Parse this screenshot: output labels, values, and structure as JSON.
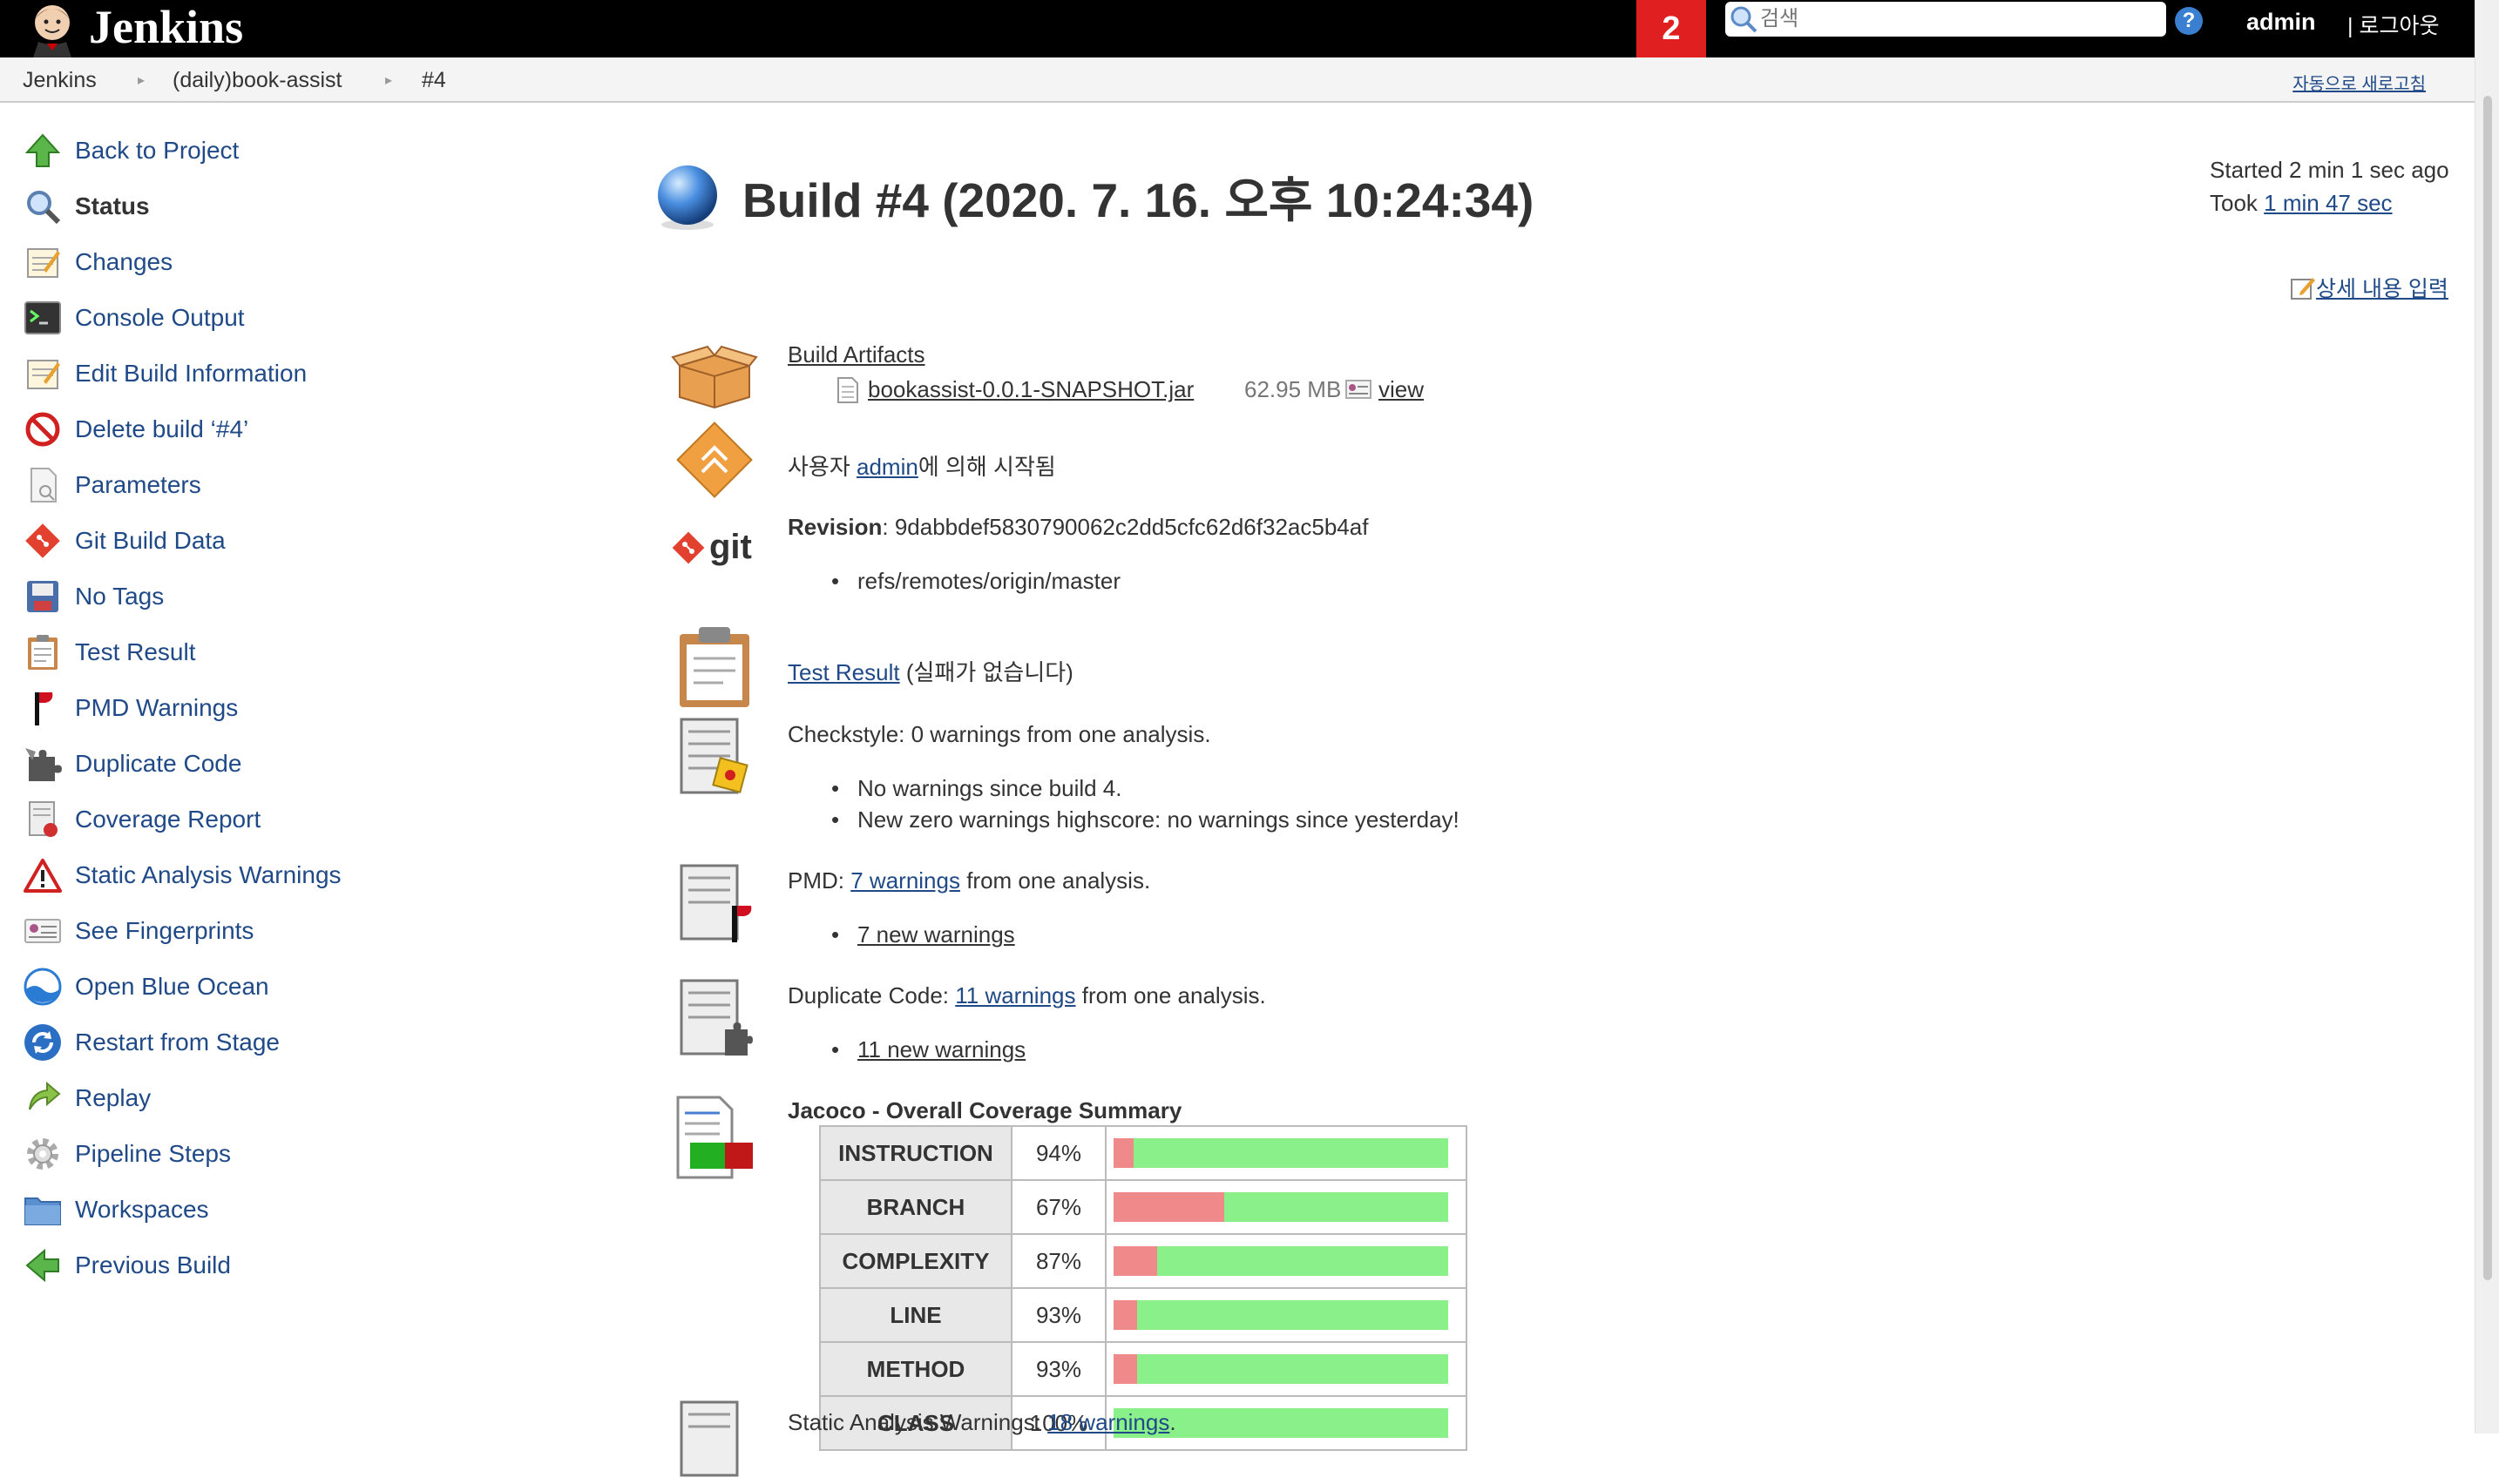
{
  "header": {
    "brand": "Jenkins",
    "notification_count": "2",
    "search_placeholder": "검색",
    "user": "admin",
    "logout": "| 로그아웃"
  },
  "breadcrumb": {
    "items": [
      "Jenkins",
      "(daily)book-assist",
      "#4"
    ],
    "auto_refresh": "자동으로 새로고침"
  },
  "sidebar": {
    "items": [
      {
        "label": "Back to Project",
        "icon": "up-arrow-icon"
      },
      {
        "label": "Status",
        "icon": "magnifier-icon"
      },
      {
        "label": "Changes",
        "icon": "notepad-icon"
      },
      {
        "label": "Console Output",
        "icon": "terminal-icon"
      },
      {
        "label": "Edit Build Information",
        "icon": "notepad-icon"
      },
      {
        "label": "Delete build ‘#4’",
        "icon": "no-entry-icon"
      },
      {
        "label": "Parameters",
        "icon": "document-search-icon"
      },
      {
        "label": "Git Build Data",
        "icon": "git-icon"
      },
      {
        "label": "No Tags",
        "icon": "floppy-icon"
      },
      {
        "label": "Test Result",
        "icon": "clipboard-icon"
      },
      {
        "label": "PMD Warnings",
        "icon": "pmd-flag-icon"
      },
      {
        "label": "Duplicate Code",
        "icon": "puzzle-icon"
      },
      {
        "label": "Coverage Report",
        "icon": "coverage-icon"
      },
      {
        "label": "Static Analysis Warnings",
        "icon": "warning-triangle-icon"
      },
      {
        "label": "See Fingerprints",
        "icon": "fingerprint-card-icon"
      },
      {
        "label": "Open Blue Ocean",
        "icon": "blue-ocean-icon"
      },
      {
        "label": "Restart from Stage",
        "icon": "restart-icon"
      },
      {
        "label": "Replay",
        "icon": "replay-arrow-icon"
      },
      {
        "label": "Pipeline Steps",
        "icon": "gear-icon"
      },
      {
        "label": "Workspaces",
        "icon": "folder-icon"
      },
      {
        "label": "Previous Build",
        "icon": "left-arrow-icon"
      }
    ]
  },
  "build": {
    "title": "Build #4 (2020. 7. 16. 오후 10:24:34)",
    "started": "Started 2 min 1 sec ago",
    "took_prefix": "Took ",
    "took_link": "1 min 47 sec",
    "edit_description": "상세 내용 입력"
  },
  "artifacts": {
    "heading": "Build Artifacts",
    "file": "bookassist-0.0.1-SNAPSHOT.jar",
    "size": "62.95 MB",
    "view": "view"
  },
  "cause": {
    "prefix": "사용자 ",
    "user": "admin",
    "suffix": "에 의해 시작됨"
  },
  "git": {
    "label": "Revision",
    "revision": ": 9dabbdef5830790062c2dd5cfc62d6f32ac5b4af",
    "ref": "refs/remotes/origin/master"
  },
  "test_result": {
    "link": "Test Result",
    "note": " (실패가 없습니다)"
  },
  "checkstyle": {
    "summary": "Checkstyle: 0 warnings from one analysis.",
    "bullets": [
      "No warnings since build 4.",
      "New zero warnings highscore: no warnings since yesterday!"
    ]
  },
  "pmd": {
    "prefix": "PMD: ",
    "link": "7 warnings",
    "suffix": " from one analysis.",
    "new_link": "7 new warnings"
  },
  "duplicate": {
    "prefix": "Duplicate Code: ",
    "link": "11 warnings",
    "suffix": " from one analysis.",
    "new_link": "11 new warnings"
  },
  "jacoco": {
    "title": "Jacoco - Overall Coverage Summary",
    "rows": [
      {
        "name": "INSTRUCTION",
        "pct": "94%",
        "value": 94
      },
      {
        "name": "BRANCH",
        "pct": "67%",
        "value": 67
      },
      {
        "name": "COMPLEXITY",
        "pct": "87%",
        "value": 87
      },
      {
        "name": "LINE",
        "pct": "93%",
        "value": 93
      },
      {
        "name": "METHOD",
        "pct": "93%",
        "value": 93
      },
      {
        "name": "CLASS",
        "pct": "100%",
        "value": 100
      }
    ],
    "colors": {
      "missed": "#f08a8a",
      "covered": "#8af08a"
    }
  },
  "static_analysis": {
    "prefix": "Static Analysis Warnings: ",
    "link": "18 warnings",
    "suffix": "."
  }
}
